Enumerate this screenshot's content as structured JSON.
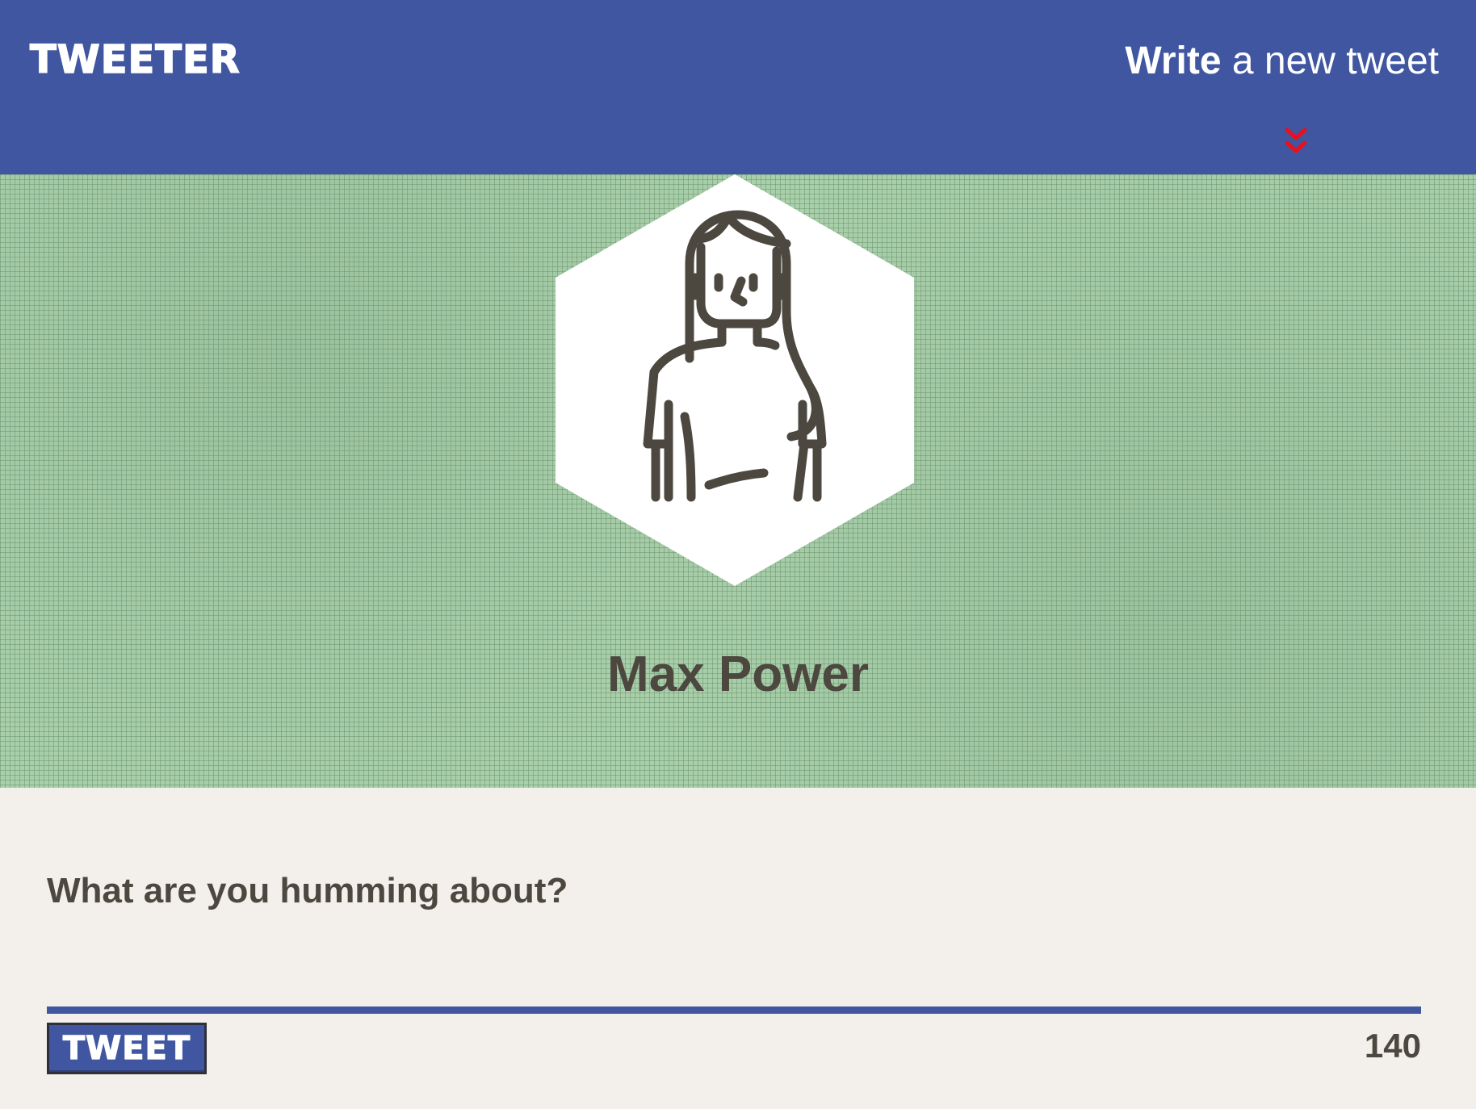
{
  "header": {
    "brand": "TWEETER",
    "compose_link": {
      "strong": "Write",
      "rest": " a new tweet"
    },
    "toggle_icon": "double-chevron-down-icon"
  },
  "profile": {
    "avatar_icon": "woman-avatar-icon",
    "name": "Max Power"
  },
  "compose": {
    "placeholder": "What are you humming about?",
    "value": "",
    "button_label": "TWEET",
    "char_count": "140"
  },
  "colors": {
    "primary": "#4056a1",
    "banner": "#a9d0ab",
    "background": "#f3f0eb",
    "text": "#4c4840",
    "toggle": "#e8101a"
  }
}
